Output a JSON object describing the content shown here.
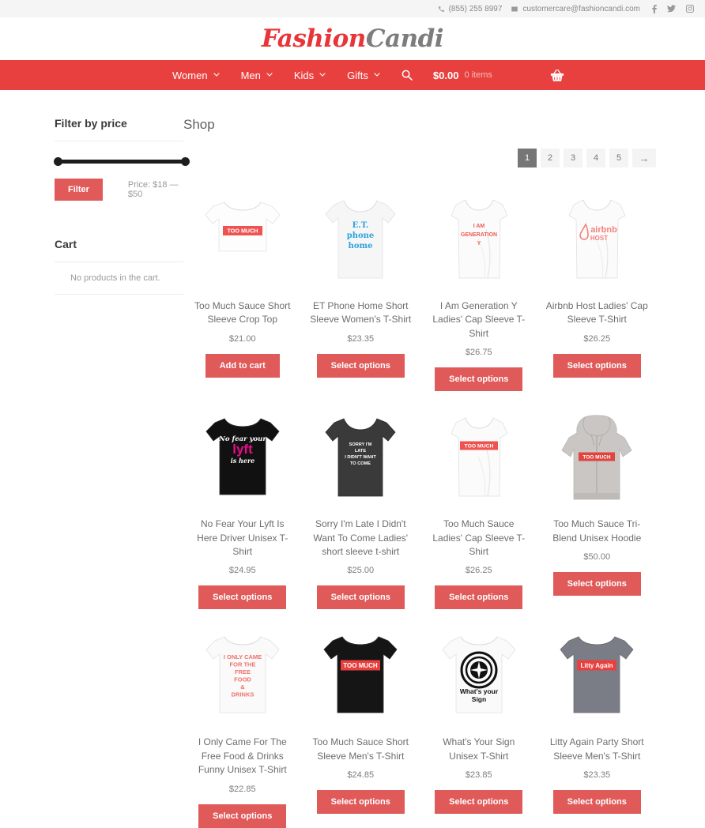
{
  "topbar": {
    "phone": "(855) 255 8997",
    "email": "customercare@fashioncandi.com",
    "phone_icon": "phone-icon",
    "email_icon": "envelope-icon",
    "social": [
      "facebook-icon",
      "twitter-icon",
      "instagram-icon"
    ]
  },
  "brand": {
    "name_part1": "Fashion",
    "name_part2": "Candi"
  },
  "nav": {
    "items": [
      {
        "label": "Women",
        "has_dropdown": true
      },
      {
        "label": "Men",
        "has_dropdown": true
      },
      {
        "label": "Kids",
        "has_dropdown": true
      },
      {
        "label": "Gifts",
        "has_dropdown": true
      }
    ],
    "search_icon": "search-icon",
    "cart_total": "$0.00",
    "cart_items": "0 items",
    "basket_icon": "basket-icon",
    "bg_color": "#e8403f"
  },
  "sidebar": {
    "filter_widget": {
      "title": "Filter by price",
      "button_label": "Filter",
      "price_label": "Price: $18 — $50",
      "min": 18,
      "max": 50
    },
    "cart_widget": {
      "title": "Cart",
      "empty_text": "No products in the cart."
    }
  },
  "shop": {
    "title": "Shop",
    "pagination": {
      "pages": [
        "1",
        "2",
        "3",
        "4",
        "5"
      ],
      "active": "1",
      "next_label": "→"
    },
    "products": [
      {
        "title": "Too Much Sauce Short Sleeve Crop Top",
        "price": "$21.00",
        "button": "Add to cart",
        "image": {
          "type": "croptop",
          "body": "#fdfdfd",
          "print_bg": "#ef5350",
          "print_text": "TOO MUCH",
          "print_color": "#ffffff"
        }
      },
      {
        "title": "ET Phone Home Short Sleeve Women's T-Shirt",
        "price": "$23.35",
        "button": "Select options",
        "image": {
          "type": "womens-tee",
          "body": "#f6f6f6",
          "print_lines": [
            "E.T.",
            "phone",
            "home"
          ],
          "print_color": "#29a3e0"
        }
      },
      {
        "title": "I Am Generation Y Ladies' Cap Sleeve T-Shirt",
        "price": "$26.75",
        "button": "Select options",
        "image": {
          "type": "cap-sleeve",
          "body": "#fbfbfb",
          "print_lines": [
            "I AM",
            "GENERATION",
            "Y"
          ],
          "print_color": "#f05a52"
        }
      },
      {
        "title": "Airbnb Host Ladies' Cap Sleeve T-Shirt",
        "price": "$26.25",
        "button": "Select options",
        "image": {
          "type": "cap-sleeve-airbnb",
          "body": "#fbfbfb",
          "print_lines": [
            "airbnb",
            "HOST"
          ],
          "print_color": "#f4827e"
        }
      },
      {
        "title": "No Fear Your Lyft Is Here Driver Unisex T-Shirt",
        "price": "$24.95",
        "button": "Select options",
        "image": {
          "type": "unisex-tee",
          "body": "#111111",
          "print_lines": [
            "No fear your",
            "lyft",
            "is here"
          ],
          "print_color": "#ffffff",
          "accent_color": "#ea0b8c"
        }
      },
      {
        "title": "Sorry I'm Late I Didn't Want To Come Ladies' short sleeve t-shirt",
        "price": "$25.00",
        "button": "Select options",
        "image": {
          "type": "ladies-tee",
          "body": "#3a3a3a",
          "print_lines": [
            "SORRY I'M",
            "LATE",
            "I DIDN'T WANT",
            "TO COME"
          ],
          "print_color": "#ffffff"
        }
      },
      {
        "title": "Too Much Sauce Ladies' Cap Sleeve T-Shirt",
        "price": "$26.25",
        "button": "Select options",
        "image": {
          "type": "cap-sleeve",
          "body": "#fbfbfb",
          "print_bg": "#ef5350",
          "print_text": "TOO MUCH",
          "print_color": "#ffffff"
        }
      },
      {
        "title": "Too Much Sauce Tri-Blend Unisex Hoodie",
        "price": "$50.00",
        "button": "Select options",
        "image": {
          "type": "hoodie",
          "body": "#c9c6c3",
          "print_bg": "#e0443f",
          "print_text": "TOO MUCH",
          "print_color": "#ffffff"
        }
      },
      {
        "title": "I Only Came For The Free Food & Drinks Funny Unisex T-Shirt",
        "price": "$22.85",
        "button": "Select options",
        "image": {
          "type": "unisex-tee",
          "body": "#fafafa",
          "print_lines": [
            "I ONLY CAME",
            "FOR THE",
            "FREE",
            "FOOD",
            "&",
            "DRINKS"
          ],
          "print_color": "#f0716b"
        }
      },
      {
        "title": "Too Much Sauce Short Sleeve Men's T-Shirt",
        "price": "$24.85",
        "button": "Select options",
        "image": {
          "type": "unisex-tee",
          "body": "#151515",
          "print_bg": "#e8403f",
          "print_text": "TOO MUCH",
          "print_color": "#ffffff"
        }
      },
      {
        "title": "What's Your Sign Unisex T-Shirt",
        "price": "$23.85",
        "button": "Select options",
        "image": {
          "type": "zodiac-tee",
          "body": "#fafafa",
          "print_lines": [
            "What's your",
            "Sign"
          ],
          "print_color": "#111111"
        }
      },
      {
        "title": "Litty Again Party Short Sleeve Men's T-Shirt",
        "price": "$23.35",
        "button": "Select options",
        "image": {
          "type": "unisex-tee",
          "body": "#7b7d86",
          "print_bg": "#e8403f",
          "print_text": "Litty Again",
          "print_color": "#ffffff"
        }
      }
    ]
  }
}
